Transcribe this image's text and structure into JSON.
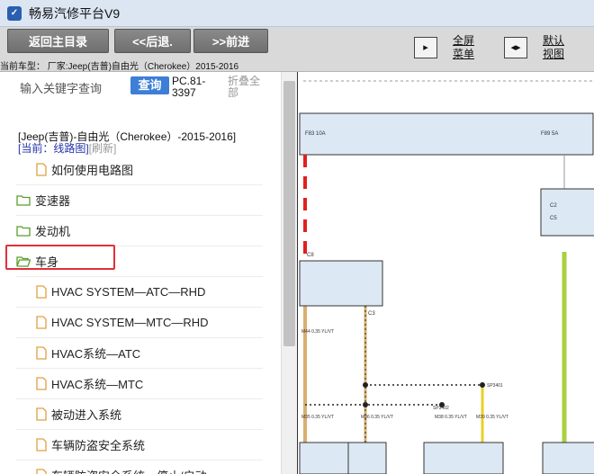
{
  "window": {
    "app_icon": "app-logo-icon",
    "title": "畅易汽修平台V9"
  },
  "toolbar": {
    "back_main": "返回主目录",
    "back": "<<后退.",
    "forward": ">>前进",
    "vehicle_label": "当前车型： 厂家:Jeep(吉普)自由光（Cherokee）2015-2016",
    "fullscreen_line1": "全屏",
    "fullscreen_line2": "菜单",
    "default_view_line1": "默认",
    "default_view_line2": "视图"
  },
  "search": {
    "placeholder": "输入关键字查询",
    "button": "查询",
    "doc_code_line1": "PC.81-",
    "doc_code_line2": "3397",
    "collapse_line1": "折叠全",
    "collapse_line2": "部"
  },
  "tree": {
    "heading": "[Jeep(吉普)-自由光（Cherokee）-2015-2016]",
    "current": "[当前：线路图]",
    "refresh": "[刷新]",
    "items": [
      {
        "label": "如何使用电路图",
        "type": "file"
      },
      {
        "label": "变速器",
        "type": "folder"
      },
      {
        "label": "发动机",
        "type": "folder"
      },
      {
        "label": "车身",
        "type": "folder-open"
      },
      {
        "label": "HVAC SYSTEM—ATC—RHD",
        "type": "file"
      },
      {
        "label": "HVAC SYSTEM—MTC—RHD",
        "type": "file"
      },
      {
        "label": "HVAC系统—ATC",
        "type": "file"
      },
      {
        "label": "HVAC系统—MTC",
        "type": "file"
      },
      {
        "label": "被动进入系统",
        "type": "file"
      },
      {
        "label": "车辆防盗安全系统",
        "type": "file"
      },
      {
        "label": "车辆防盗安全系统—停止/启动",
        "type": "file"
      }
    ]
  },
  "diagram": {
    "fuse_left": "F83 10A",
    "fuse_right": "F89 5A",
    "connectors": [
      "C2",
      "C3",
      "C5",
      "C8"
    ],
    "wires": [
      "M35 0.35 YL/VT",
      "M36 0.35 YL/VT",
      "M38 0.35 YL/VT",
      "M39 0.35 YL/VT",
      "M44 0.35 YL/VT"
    ],
    "splices": [
      "SP3401",
      "SP3402"
    ],
    "colors": {
      "wire_red": "#e02020",
      "wire_green": "#a8d040",
      "wire_tan": "#d8b070",
      "wire_yellow": "#e8d028",
      "module_fill": "#dce8f4"
    }
  }
}
